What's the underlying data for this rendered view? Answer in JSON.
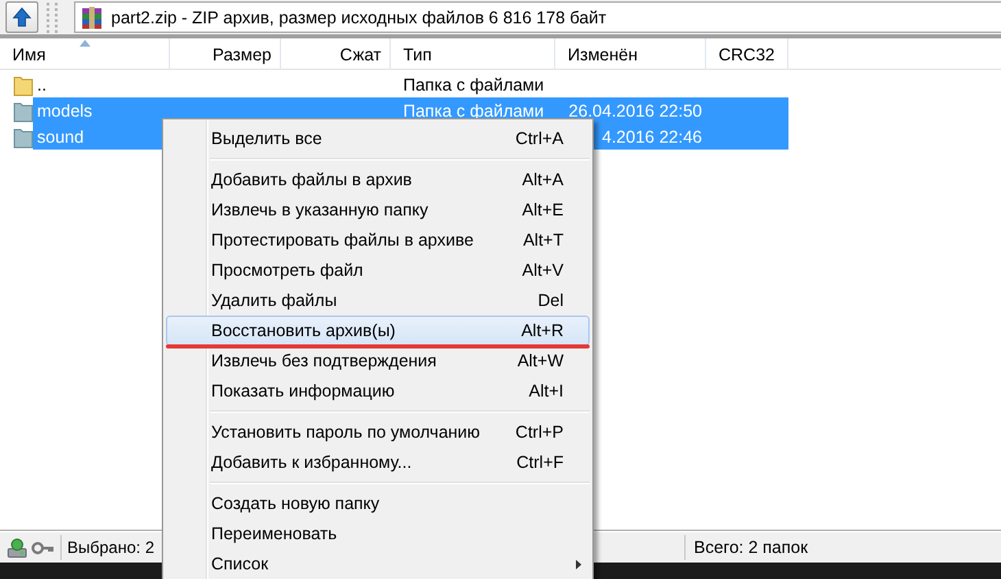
{
  "address": {
    "text": "part2.zip - ZIP архив, размер исходных файлов 6 816 178 байт"
  },
  "columns": [
    {
      "label": "Имя",
      "sorted": true
    },
    {
      "label": "Размер",
      "sorted": false
    },
    {
      "label": "Сжат",
      "sorted": false
    },
    {
      "label": "Тип",
      "sorted": false
    },
    {
      "label": "Изменён",
      "sorted": false
    },
    {
      "label": "CRC32",
      "sorted": false
    }
  ],
  "rows": [
    {
      "name": "..",
      "type": "Папка с файлами",
      "selected": false
    },
    {
      "name": "models",
      "type": "Папка с файлами",
      "modified": "26.04.2016 22:50",
      "selected": true
    },
    {
      "name": "sound",
      "modified": "4.2016 22:46",
      "selected": true
    }
  ],
  "context_menu": {
    "sections": [
      [
        {
          "label": "Выделить все",
          "shortcut": "Ctrl+A",
          "selected": false,
          "underlined": false,
          "submenu": false
        }
      ],
      [
        {
          "label": "Добавить файлы в архив",
          "shortcut": "Alt+A",
          "selected": false,
          "underlined": false,
          "submenu": false
        },
        {
          "label": "Извлечь в указанную папку",
          "shortcut": "Alt+E",
          "selected": false,
          "underlined": false,
          "submenu": false
        },
        {
          "label": "Протестировать файлы в архиве",
          "shortcut": "Alt+T",
          "selected": false,
          "underlined": false,
          "submenu": false
        },
        {
          "label": "Просмотреть файл",
          "shortcut": "Alt+V",
          "selected": false,
          "underlined": false,
          "submenu": false
        },
        {
          "label": "Удалить файлы",
          "shortcut": "Del",
          "selected": false,
          "underlined": false,
          "submenu": false
        },
        {
          "label": "Восстановить архив(ы)",
          "shortcut": "Alt+R",
          "selected": true,
          "underlined": true,
          "submenu": false
        },
        {
          "label": "Извлечь без подтверждения",
          "shortcut": "Alt+W",
          "selected": false,
          "underlined": false,
          "submenu": false
        },
        {
          "label": "Показать информацию",
          "shortcut": "Alt+I",
          "selected": false,
          "underlined": false,
          "submenu": false
        }
      ],
      [
        {
          "label": "Установить пароль по умолчанию",
          "shortcut": "Ctrl+P",
          "selected": false,
          "underlined": false,
          "submenu": false
        },
        {
          "label": "Добавить к избранному...",
          "shortcut": "Ctrl+F",
          "selected": false,
          "underlined": false,
          "submenu": false
        }
      ],
      [
        {
          "label": "Создать новую папку",
          "selected": false,
          "underlined": false,
          "submenu": false
        },
        {
          "label": "Переименовать",
          "selected": false,
          "underlined": false,
          "submenu": false
        },
        {
          "label": "Список",
          "selected": false,
          "underlined": false,
          "submenu": true
        }
      ]
    ]
  },
  "status_bar": {
    "selected_text": "Выбрано: 2",
    "total_text": "Всего: 2 папок"
  }
}
